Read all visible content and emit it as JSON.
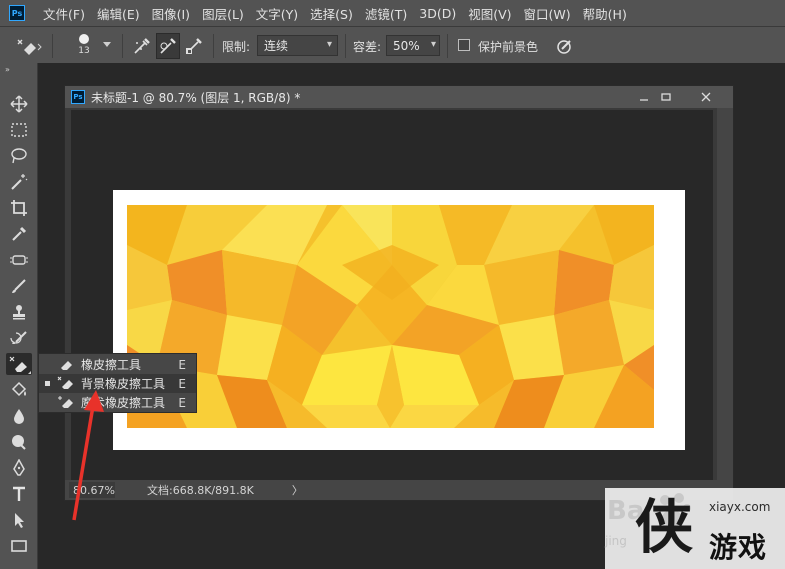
{
  "app": {
    "logo_text": "Ps"
  },
  "menubar": {
    "items": [
      "文件(F)",
      "编辑(E)",
      "图像(I)",
      "图层(L)",
      "文字(Y)",
      "选择(S)",
      "滤镜(T)",
      "3D(D)",
      "视图(V)",
      "窗口(W)",
      "帮助(H)"
    ]
  },
  "options": {
    "brush_size": "13",
    "limit_label": "限制:",
    "limit_value": "连续",
    "tolerance_label": "容差:",
    "tolerance_value": "50%",
    "protect_label": "保护前景色",
    "protect_checked": false
  },
  "document": {
    "title": "未标题-1 @ 80.7% (图层 1, RGB/8) *",
    "zoom": "80.67%",
    "info": "文档:668.8K/891.8K",
    "status_arrow": "〉"
  },
  "flyout": {
    "items": [
      {
        "label": "橡皮擦工具",
        "key": "E",
        "icon": "eraser-icon",
        "selected": false
      },
      {
        "label": "背景橡皮擦工具",
        "key": "E",
        "icon": "background-eraser-icon",
        "selected": true
      },
      {
        "label": "魔术橡皮擦工具",
        "key": "E",
        "icon": "magic-eraser-icon",
        "selected": false
      }
    ]
  },
  "tools": [
    "move-tool-icon",
    "marquee-tool-icon",
    "lasso-tool-icon",
    "magic-wand-tool-icon",
    "crop-tool-icon",
    "eyedropper-tool-icon",
    "healing-brush-tool-icon",
    "brush-tool-icon",
    "stamp-tool-icon",
    "history-brush-tool-icon",
    "eraser-tool-icon",
    "paint-bucket-tool-icon",
    "blur-tool-icon",
    "dodge-tool-icon",
    "pen-tool-icon",
    "type-tool-icon",
    "path-selection-tool-icon",
    "rectangle-tool-icon"
  ],
  "colors": {
    "chrome": "#535353",
    "workspace": "#282828",
    "accent_ps": "#31a8ff",
    "arrow": "#e8322a"
  },
  "watermark": {
    "baidu_text": "Ba",
    "baidu_sub": "jing",
    "logo_char": "侠",
    "site": "xiayx.com",
    "brand": "游戏"
  }
}
